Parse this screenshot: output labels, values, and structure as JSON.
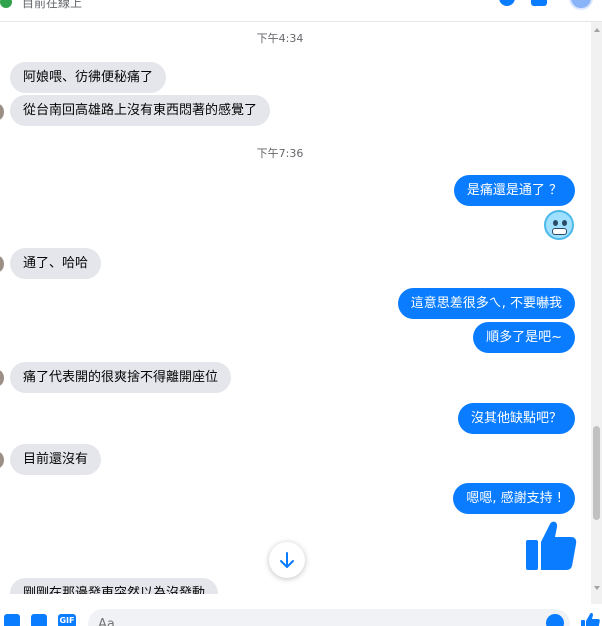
{
  "header": {
    "status_text": "目前在線上"
  },
  "timestamps": [
    "下午4:34",
    "下午7:36"
  ],
  "messages": [
    {
      "dir": "in",
      "text": "阿娘喂、彷彿便秘痛了"
    },
    {
      "dir": "in",
      "text": "從台南回高雄路上沒有東西悶著的感覺了"
    },
    {
      "dir": "out",
      "text": "是痛還是通了 ？"
    },
    {
      "dir": "in",
      "text": "通了、哈哈"
    },
    {
      "dir": "out",
      "text": "這意思差很多ㄟ, 不要嚇我"
    },
    {
      "dir": "out",
      "text": "順多了是吧~"
    },
    {
      "dir": "in",
      "text": "痛了代表開的很爽捨不得離開座位"
    },
    {
      "dir": "out",
      "text": "沒其他缺點吧？"
    },
    {
      "dir": "in",
      "text": "目前還沒有"
    },
    {
      "dir": "out",
      "text": "嗯嗯, 感謝支持 !"
    },
    {
      "dir": "in",
      "text": "剛剛在那邊發東突然以為沒發動"
    }
  ],
  "composer": {
    "placeholder": "Aa",
    "gif_label": "GIF"
  },
  "colors": {
    "accent": "#0a7cff",
    "incoming_bubble": "#e4e6eb",
    "online": "#31a24c"
  }
}
